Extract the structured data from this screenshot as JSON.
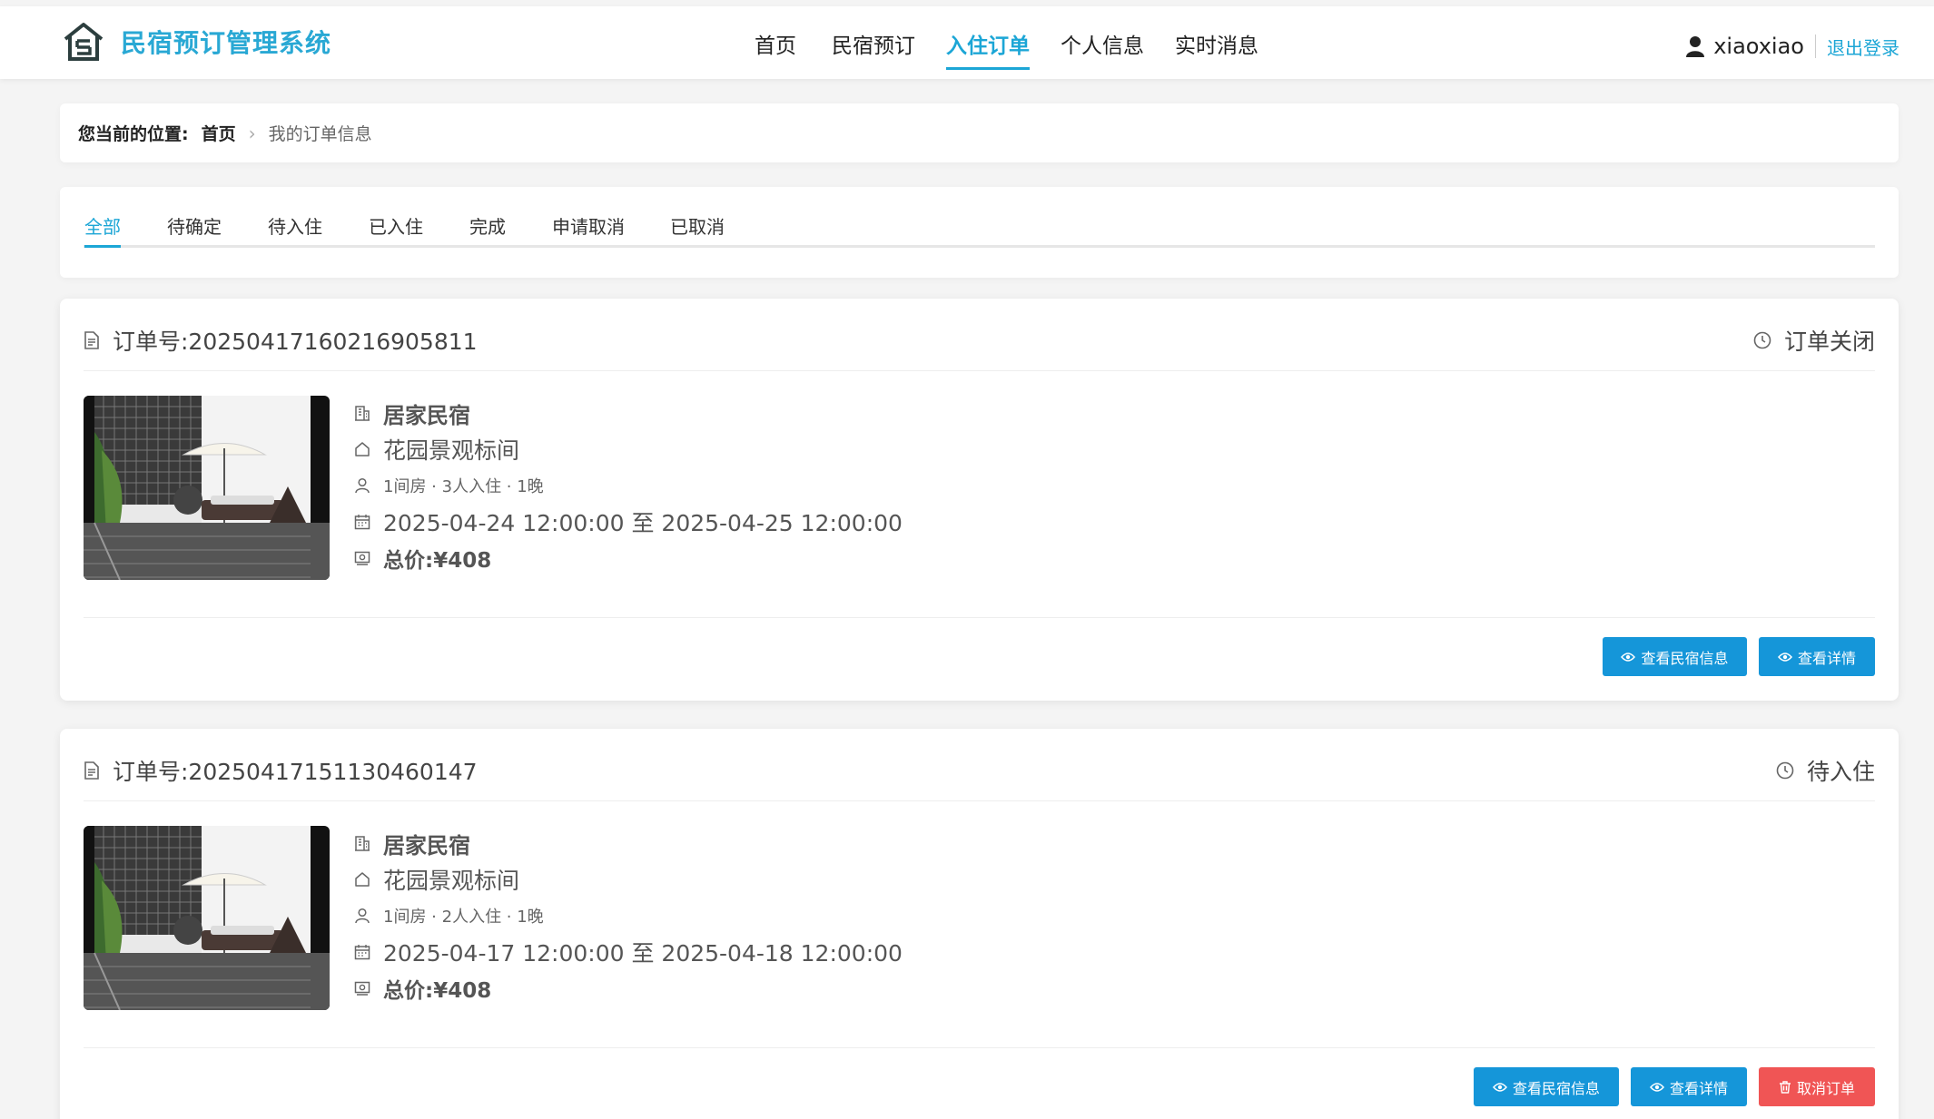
{
  "app": {
    "title": "民宿预订管理系统"
  },
  "nav": {
    "items": [
      {
        "label": "首页"
      },
      {
        "label": "民宿预订"
      },
      {
        "label": "入住订单"
      },
      {
        "label": "个人信息"
      },
      {
        "label": "实时消息"
      }
    ],
    "active": "入住订单"
  },
  "user": {
    "name": "xiaoxiao",
    "logout_label": "退出登录"
  },
  "breadcrumb": {
    "label": "您当前的位置:",
    "home": "首页",
    "current": "我的订单信息"
  },
  "tabs": {
    "items": [
      {
        "label": "全部"
      },
      {
        "label": "待确定"
      },
      {
        "label": "待入住"
      },
      {
        "label": "已入住"
      },
      {
        "label": "完成"
      },
      {
        "label": "申请取消"
      },
      {
        "label": "已取消"
      }
    ],
    "active": "全部"
  },
  "orders": [
    {
      "order_no": "订单号:20250417160216905811",
      "status": "订单关闭",
      "homestay": "居家民宿",
      "room": "花园景观标间",
      "guests": "1间房 · 3人入住 · 1晚",
      "dates": "2025-04-24 12:00:00 至 2025-04-25 12:00:00",
      "price": "总价:¥408",
      "buttons": {
        "view_homestay": "查看民宿信息",
        "view_detail": "查看详情"
      }
    },
    {
      "order_no": "订单号:20250417151130460147",
      "status": "待入住",
      "homestay": "居家民宿",
      "room": "花园景观标间",
      "guests": "1间房 · 2人入住 · 1晚",
      "dates": "2025-04-17 12:00:00 至 2025-04-18 12:00:00",
      "price": "总价:¥408",
      "buttons": {
        "view_homestay": "查看民宿信息",
        "view_detail": "查看详情",
        "cancel": "取消订单"
      }
    }
  ],
  "colors": {
    "accent": "#1ca6d6",
    "button_blue": "#1596d9",
    "button_red": "#f05555",
    "background": "#f4f4f4"
  }
}
